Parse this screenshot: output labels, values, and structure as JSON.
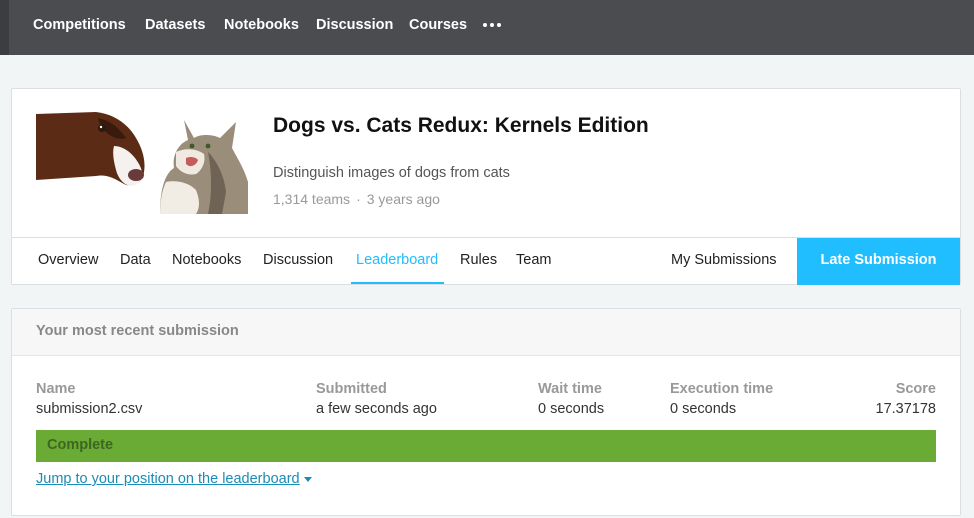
{
  "topnav": {
    "items": [
      "Competitions",
      "Datasets",
      "Notebooks",
      "Discussion",
      "Courses"
    ],
    "more_icon": "more-horizontal-icon"
  },
  "competition": {
    "title": "Dogs vs. Cats Redux: Kernels Edition",
    "description": "Distinguish images of dogs from cats",
    "teams": "1,314 teams",
    "separator": "·",
    "age": "3 years ago"
  },
  "tabs": {
    "items": [
      "Overview",
      "Data",
      "Notebooks",
      "Discussion",
      "Leaderboard",
      "Rules",
      "Team"
    ],
    "active": "Leaderboard",
    "my_submissions": "My Submissions",
    "late_submission": "Late Submission"
  },
  "submission": {
    "heading": "Your most recent submission",
    "columns": {
      "name": "Name",
      "submitted": "Submitted",
      "wait_time": "Wait time",
      "execution_time": "Execution time",
      "score": "Score"
    },
    "values": {
      "name": "submission2.csv",
      "submitted": "a few seconds ago",
      "wait_time": "0 seconds",
      "execution_time": "0 seconds",
      "score": "17.37178"
    },
    "status": "Complete",
    "jump_link": "Jump to your position on the leaderboard"
  },
  "colors": {
    "accent": "#20beff",
    "topnav": "#4b4c4f",
    "status_complete": "#69ab34",
    "link": "#1a8cb8"
  }
}
